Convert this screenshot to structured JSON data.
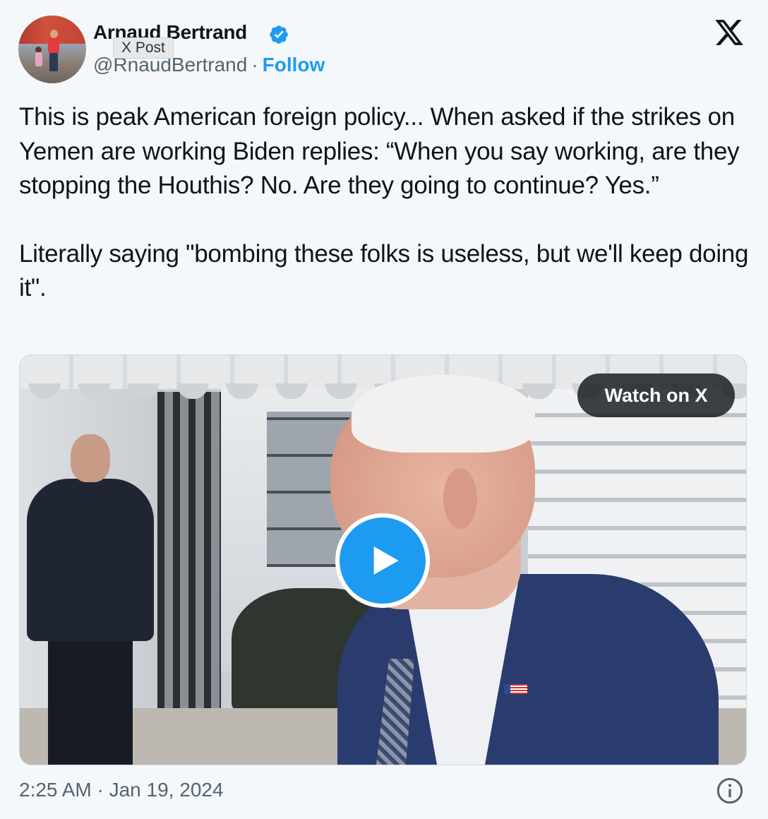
{
  "author": {
    "name": "Arnaud Bertrand",
    "handle": "@RnaudBertrand",
    "separator": "·",
    "follow_label": "Follow"
  },
  "tooltip": "X Post",
  "icons": {
    "verified": "verified-badge-icon",
    "logo": "x-logo-icon",
    "play": "play-icon",
    "info": "info-icon"
  },
  "tweet": {
    "paragraphs": [
      "This is peak American foreign policy... When asked if the strikes on Yemen are working Biden replies: “When you say working, are they stopping the Houthis? No. Are they going to continue? Yes.”",
      "Literally saying \"bombing these folks is useless, but we'll keep doing it\"."
    ]
  },
  "media": {
    "watch_label": "Watch on X"
  },
  "footer": {
    "timestamp": "2:25 AM · Jan 19, 2024"
  },
  "colors": {
    "accent": "#1d9bf0",
    "muted": "#536471",
    "background": "#f5f8fa"
  }
}
